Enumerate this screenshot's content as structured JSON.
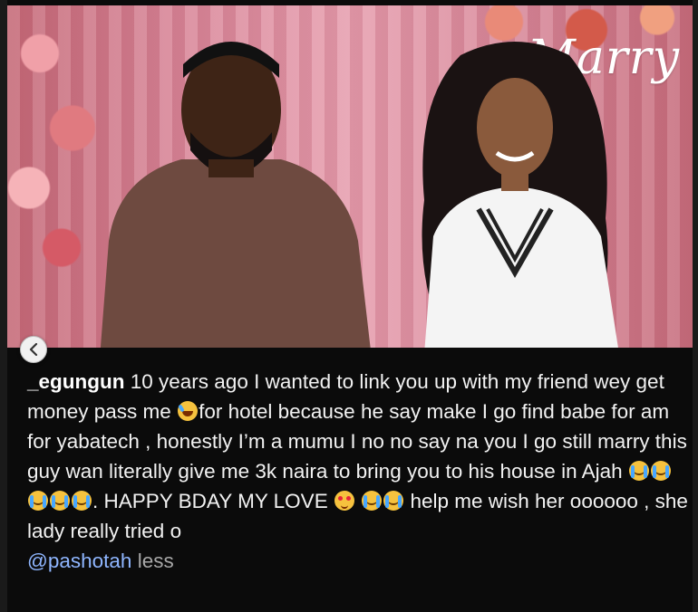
{
  "post": {
    "username": "_egungun",
    "caption_parts": [
      " 10 years ago I wanted to link you up with my friend wey get money pass me ",
      "for hotel because he say make I go find babe for am for yabatech , honestly I’m a mumu I no no say na you I go still marry this guy wan literally give me 3k naira to bring you to his house in Ajah ",
      ". HAPPY BDAY MY LOVE ",
      " help me wish her oooooo , she lady really tried o "
    ],
    "mention": "@pashotah",
    "less_label": " less"
  },
  "photo": {
    "sign_text": "Marry"
  },
  "icons": {
    "prev": "chevron-left-icon",
    "laugh": "rolling-on-floor-laughing-icon",
    "cry": "loudly-crying-face-icon",
    "heart_eyes": "heart-eyes-icon"
  },
  "colors": {
    "background": "#0b0b0b",
    "caption_text": "#f2f2f2",
    "mention": "#8fb6ff",
    "less": "#a8a8a8"
  }
}
